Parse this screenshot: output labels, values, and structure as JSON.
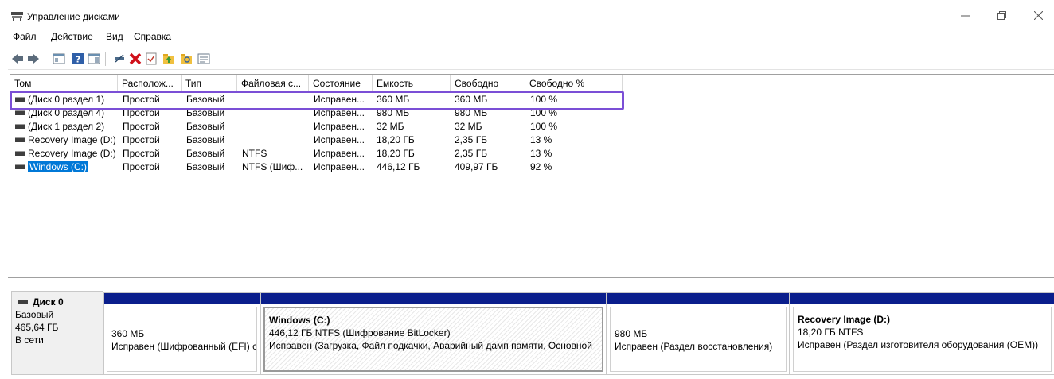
{
  "window": {
    "title": "Управление дисками",
    "icon": "disk-management-icon"
  },
  "menu": [
    "Файл",
    "Действие",
    "Вид",
    "Справка"
  ],
  "toolbar": [
    "back-arrow-icon",
    "forward-arrow-icon",
    "console-tree-icon",
    "help-icon",
    "action-pane-icon",
    "connect-icon",
    "delete-icon",
    "properties-check-icon",
    "up-folder-icon",
    "search-folder-icon",
    "settings-list-icon"
  ],
  "volume_table": {
    "columns": [
      "Том",
      "Располож...",
      "Тип",
      "Файловая с...",
      "Состояние",
      "Емкость",
      "Свободно",
      "Свободно %"
    ],
    "rows": [
      [
        "(Диск 0 раздел 1)",
        "Простой",
        "Базовый",
        "",
        "Исправен...",
        "360 МБ",
        "360 МБ",
        "100 %"
      ],
      [
        "(Диск 0 раздел 4)",
        "Простой",
        "Базовый",
        "",
        "Исправен...",
        "980 МБ",
        "980 МБ",
        "100 %"
      ],
      [
        "(Диск 1 раздел 2)",
        "Простой",
        "Базовый",
        "",
        "Исправен...",
        "32 МБ",
        "32 МБ",
        "100 %"
      ],
      [
        "Recovery Image (D:)",
        "Простой",
        "Базовый",
        "",
        "Исправен...",
        "18,20 ГБ",
        "2,35 ГБ",
        "13 %"
      ],
      [
        "Recovery Image (D:)",
        "Простой",
        "Базовый",
        "NTFS",
        "Исправен...",
        "18,20 ГБ",
        "2,35 ГБ",
        "13 %"
      ],
      [
        "Windows (C:)",
        "Простой",
        "Базовый",
        "NTFS (Шиф...",
        "Исправен...",
        "446,12 ГБ",
        "409,97 ГБ",
        "92 %"
      ]
    ],
    "selected_row": 5
  },
  "disk": {
    "name": "Диск 0",
    "type": "Базовый",
    "size": "465,64 ГБ",
    "status": "В сети",
    "partitions": [
      {
        "title": "",
        "size": "360 МБ",
        "status": "Исправен (Шифрованный (EFI) с"
      },
      {
        "title": "Windows  (C:)",
        "size": "446,12 ГБ NTFS (Шифрование BitLocker)",
        "status": "Исправен (Загрузка, Файл подкачки, Аварийный дамп памяти, Основной"
      },
      {
        "title": "",
        "size": "980 МБ",
        "status": "Исправен (Раздел восстановления)"
      },
      {
        "title": "Recovery Image  (D:)",
        "size": "18,20 ГБ NTFS",
        "status": "Исправен (Раздел изготовителя оборудования (OEM))"
      }
    ]
  }
}
